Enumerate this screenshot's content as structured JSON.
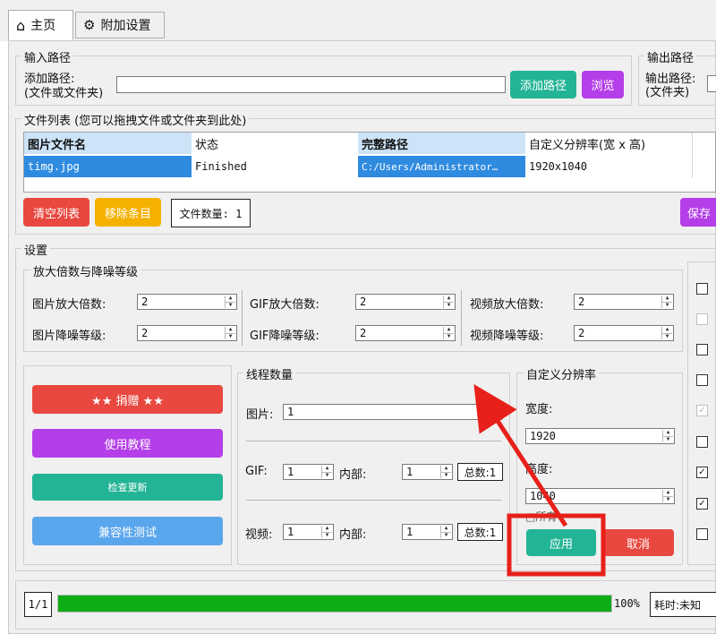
{
  "tabs": {
    "home": "主页",
    "extra": "附加设置"
  },
  "input_path": {
    "group_label": "输入路径",
    "field_label_1": "添加路径:",
    "field_label_2": "(文件或文件夹)",
    "value": "",
    "add_button": "添加路径",
    "browse_button": "浏览"
  },
  "output_path": {
    "group_label": "输出路径",
    "field_label_1": "输出路径:",
    "field_label_2": "(文件夹)"
  },
  "file_list": {
    "group_label": "文件列表 (您可以拖拽文件或文件夹到此处)",
    "columns": [
      "图片文件名",
      "状态",
      "完整路径",
      "自定义分辨率(宽 x 高)"
    ],
    "rows": [
      [
        "timg.jpg",
        "Finished",
        "C:/Users/Administrator…",
        "1920x1040"
      ]
    ],
    "clear_button": "清空列表",
    "remove_button": "移除条目",
    "count_text": "文件数量: 1",
    "save_button": "保存"
  },
  "settings": {
    "group_label": "设置",
    "scale": {
      "group_label": "放大倍数与降噪等级",
      "image_scale_label": "图片放大倍数:",
      "image_scale_value": "2",
      "image_denoise_label": "图片降噪等级:",
      "image_denoise_value": "2",
      "gif_scale_label": "GIF放大倍数:",
      "gif_scale_value": "2",
      "gif_denoise_label": "GIF降噪等级:",
      "gif_denoise_value": "2",
      "video_scale_label": "视频放大倍数:",
      "video_scale_value": "2",
      "video_denoise_label": "视频降噪等级:",
      "video_denoise_value": "2"
    },
    "action_buttons": {
      "donate": "★★ 捐赠 ★★",
      "tutorial": "使用教程",
      "update": "检查更新",
      "compat": "兼容性测试"
    },
    "threads": {
      "group_label": "线程数量",
      "image_label": "图片:",
      "image_value": "1",
      "gif_label": "GIF:",
      "gif_value": "1",
      "gif_inner_label": "内部:",
      "gif_inner_value": "1",
      "gif_total": "总数:1",
      "video_label": "视频:",
      "video_value": "1",
      "video_inner_label": "内部:",
      "video_inner_value": "1",
      "video_total": "总数:1"
    },
    "custom_res": {
      "group_label": "自定义分辨率",
      "width_label": "宽度:",
      "width_value": "1920",
      "height_label": "高度:",
      "height_value": "1040",
      "partial_label": "□所有",
      "apply_button": "应用",
      "cancel_button": "取消"
    }
  },
  "progress": {
    "page_text": "1/1",
    "percent": 100,
    "percent_text": "100%",
    "time_text": "耗时:未知"
  },
  "colors": {
    "red_button": "#e8483f",
    "orange_button": "#f5b100",
    "teal_button": "#23b495",
    "purple_button": "#b43ee8",
    "blue_button": "#5aa6ec",
    "selection_blue": "#2f8be0",
    "progress_green": "#0ead16",
    "annotation_red": "#e8201a"
  }
}
